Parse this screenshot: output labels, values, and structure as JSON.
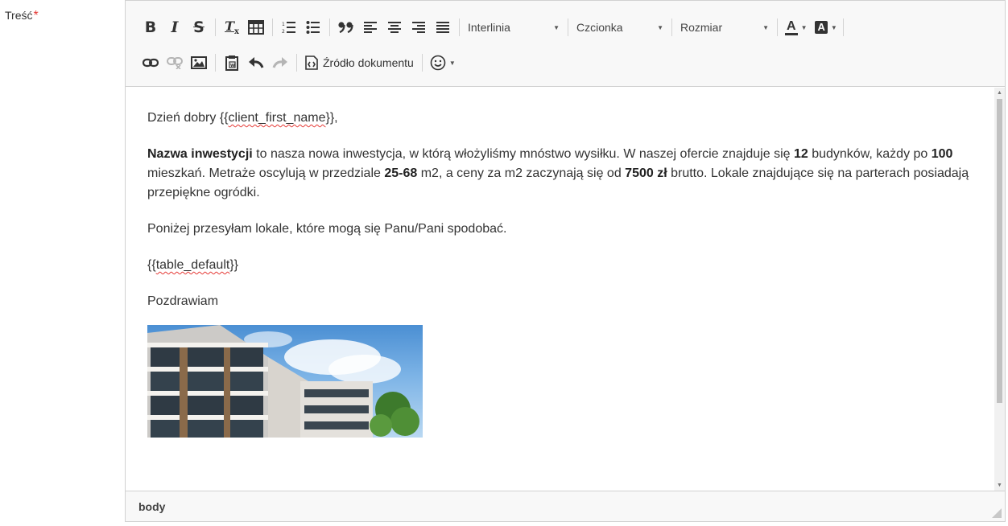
{
  "field": {
    "label": "Treść",
    "required_mark": "*"
  },
  "toolbar": {
    "bold": "B",
    "italic": "I",
    "strike": "S",
    "remove_format_main": "T",
    "remove_format_sub": "x",
    "line_height": "Interlinia",
    "font": "Czcionka",
    "size": "Rozmiar",
    "text_color": "A",
    "bg_color": "A",
    "source": "Źródło dokumentu",
    "icons": {
      "table": "table-icon",
      "numbered_list": "numbered-list-icon",
      "bulleted_list": "bulleted-list-icon",
      "blockquote": "blockquote-icon",
      "align_left": "align-left-icon",
      "align_center": "align-center-icon",
      "align_right": "align-right-icon",
      "justify": "justify-icon",
      "link": "link-icon",
      "unlink": "unlink-icon",
      "image": "image-icon",
      "paste_word": "paste-word-icon",
      "undo": "undo-icon",
      "redo": "redo-icon",
      "source": "source-icon",
      "emoji": "smiley-icon"
    }
  },
  "content": {
    "greeting_prefix": "Dzień dobry {{",
    "greeting_var": "client_first_name",
    "greeting_suffix": "}},",
    "p2": {
      "investment": "Nazwa inwestycji",
      "t1": " to nasza nowa inwestycja, w którą włożyliśmy mnóstwo wysiłku. W naszej ofercie znajduje się ",
      "buildings": "12",
      "t2": " budynków, każdy po ",
      "flats": "100",
      "t3": " mieszkań. Metraże oscylują w przedziale ",
      "area": "25-68",
      "t4": " m2, a ceny za m2 zaczynają się od ",
      "price": "7500 zł",
      "t5": " brutto. Lokale znajdujące się na parterach posiadają przepiękne ogródki."
    },
    "p3": "Poniżej przesyłam lokale, które mogą się Panu/Pani spodobać.",
    "table_prefix": "{{",
    "table_var": "table_default",
    "table_suffix": "}}",
    "closing": "Pozdrawiam"
  },
  "status": {
    "path": "body"
  },
  "colors": {
    "required": "#e53935",
    "border": "#d1d1d1",
    "toolbar_bg": "#f8f8f8"
  }
}
